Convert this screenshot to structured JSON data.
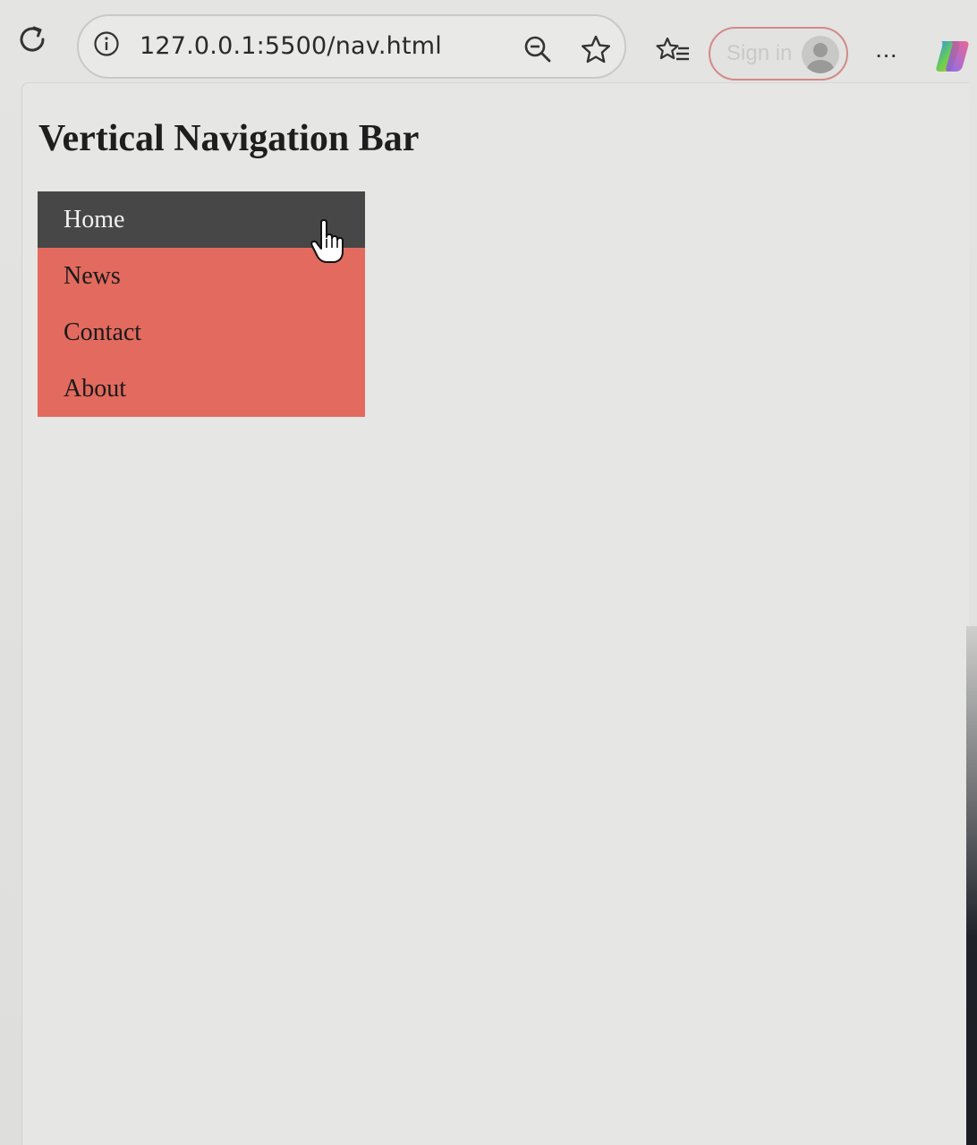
{
  "browser": {
    "url": "127.0.0.1:5500/nav.html",
    "sign_in_label": "Sign in",
    "more_label": "···"
  },
  "page": {
    "title": "Vertical Navigation Bar",
    "nav": {
      "items": [
        {
          "label": "Home",
          "state": "hovered"
        },
        {
          "label": "News",
          "state": "normal"
        },
        {
          "label": "Contact",
          "state": "normal"
        },
        {
          "label": "About",
          "state": "normal"
        }
      ],
      "colors": {
        "background": "#e26a5e",
        "hover_background": "#474747",
        "hover_text": "#f2f2f2",
        "text": "#1a1a1a"
      }
    }
  },
  "icons": [
    "reload-icon",
    "site-info-icon",
    "zoom-out-icon",
    "favorite-star-icon",
    "favorites-list-icon",
    "profile-avatar-icon",
    "more-options-icon",
    "copilot-icon",
    "hand-pointer-icon"
  ]
}
